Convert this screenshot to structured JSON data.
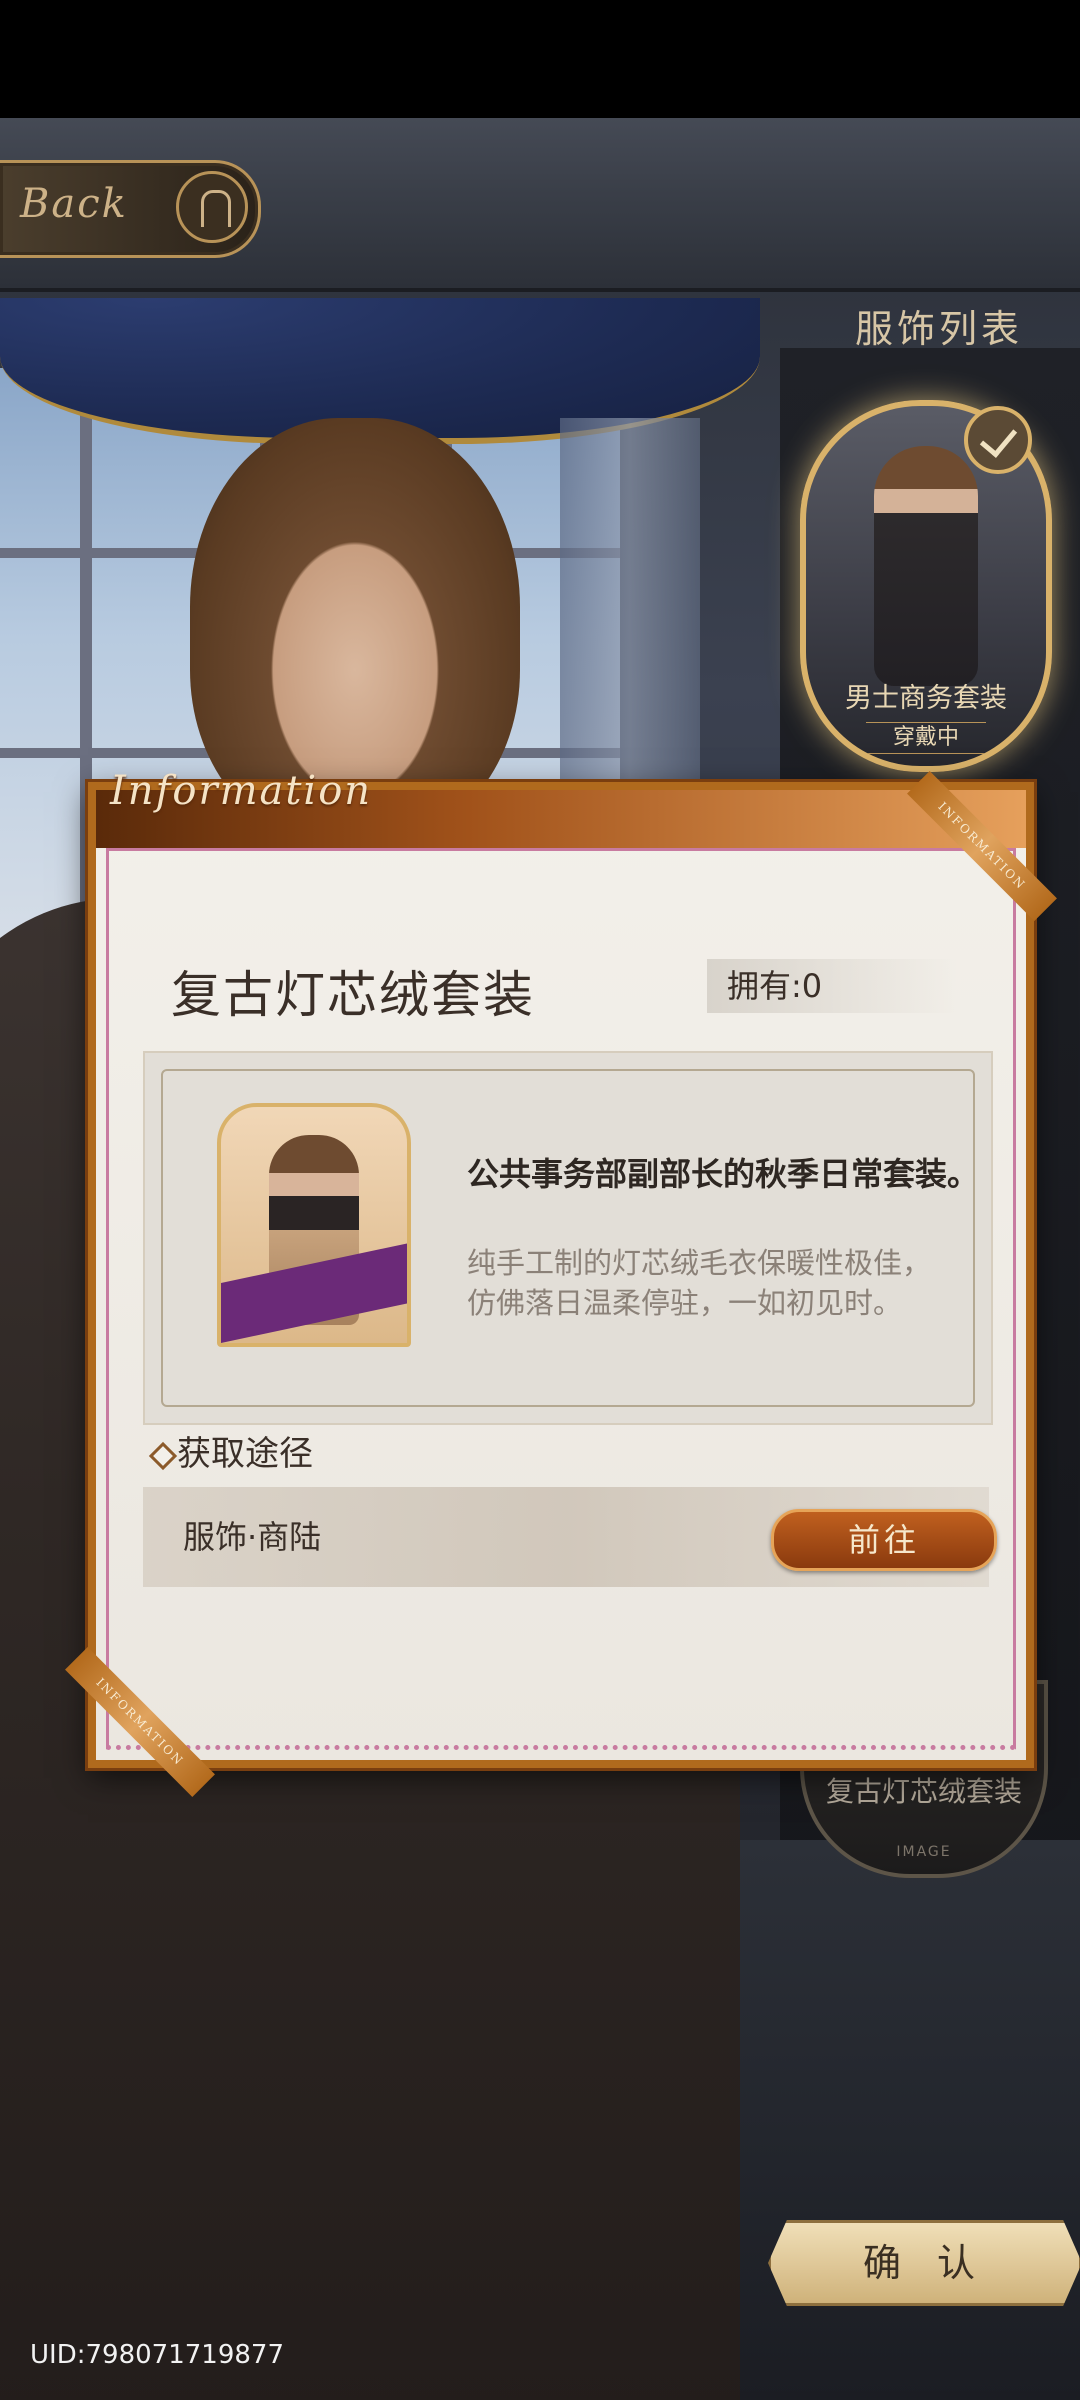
{
  "back_label": "Back",
  "outfit_list": {
    "title": "服饰列表",
    "current": {
      "name": "男士商务套装",
      "status": "穿戴中"
    },
    "second": {
      "name": "复古灯芯绒套装",
      "tag": "IMAGE"
    }
  },
  "info_panel": {
    "header": "Information",
    "ribbon_text": "INFORMATION",
    "item_name": "复古灯芯绒套装",
    "owned": "拥有:0",
    "desc_bold": "公共事务部副部长的秋季日常套装。",
    "desc_body": "纯手工制的灯芯绒毛衣保暖性极佳，仿佛落日温柔停驻，一如初见时。",
    "acquire_title": "获取途径",
    "acquire_source": "服饰·商陆",
    "goto_label": "前往"
  },
  "confirm_label": "确 认",
  "uid": "UID:798071719877",
  "colors": {
    "panel_border": "#b06a1d",
    "goto_button": "#a24a15",
    "accent_gold": "#d9b26a"
  }
}
